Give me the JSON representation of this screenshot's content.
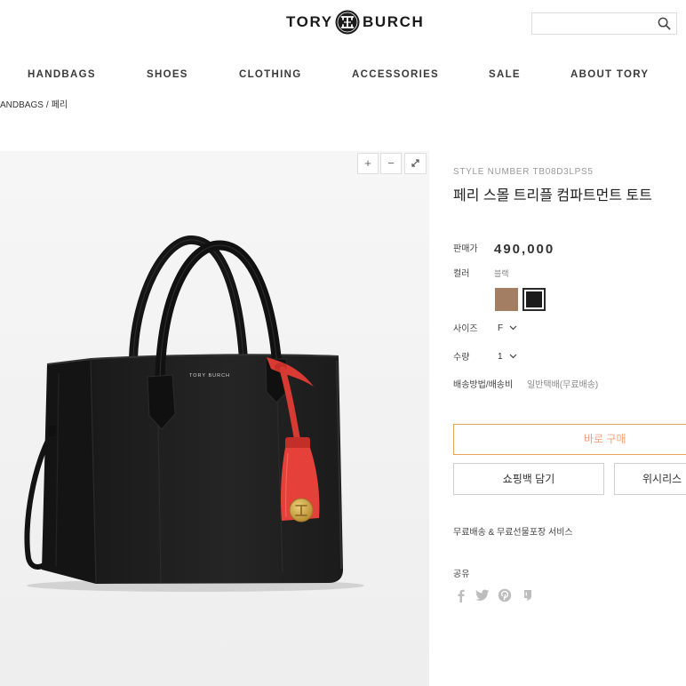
{
  "header": {
    "logo_left": "TORY",
    "logo_right": "BURCH",
    "logo_icon": "tory-burch-emblem-icon",
    "search_icon": "search-icon"
  },
  "nav": {
    "items": [
      "HANDBAGS",
      "SHOES",
      "CLOTHING",
      "ACCESSORIES",
      "SALE",
      "ABOUT TORY"
    ]
  },
  "breadcrumb": {
    "items": [
      "ANDBAGS",
      "페리"
    ],
    "separator": "/"
  },
  "gallery": {
    "zoom_in": "+",
    "zoom_out": "−",
    "expand_icon": "expand-icon",
    "bag_logo": "TORY BURCH"
  },
  "product": {
    "style_label": "STYLE NUMBER",
    "style_number": "TB08D3LPS5",
    "title": "페리 스몰 트리플 컴파트먼트 토트",
    "price_label": "판매가",
    "price": "490,000",
    "color_label": "컬러",
    "color_value": "블랙",
    "swatches": [
      {
        "hex": "#a47e63",
        "selected": false
      },
      {
        "hex": "#1c1c1c",
        "selected": true
      }
    ],
    "size_label": "사이즈",
    "size_value": "F",
    "qty_label": "수량",
    "qty_value": "1",
    "shipping_label": "배송방법/배송비",
    "shipping_value": "일반택배(무료배송)"
  },
  "actions": {
    "buy_now": "바로 구매",
    "add_to_bag": "쇼핑백 담기",
    "wishlist": "위시리스"
  },
  "service_note": "무료배송 & 무료선물포장 서비스",
  "share": {
    "label": "공유",
    "icons": [
      "facebook-icon",
      "twitter-icon",
      "pinterest-icon",
      "kakao-story-icon"
    ]
  },
  "colors": {
    "accent": "#f0a37c",
    "accent_border": "#e9a260",
    "bag": "#1c1c1c",
    "tassel": "#e5413a",
    "medallion": "#c9a24a"
  }
}
